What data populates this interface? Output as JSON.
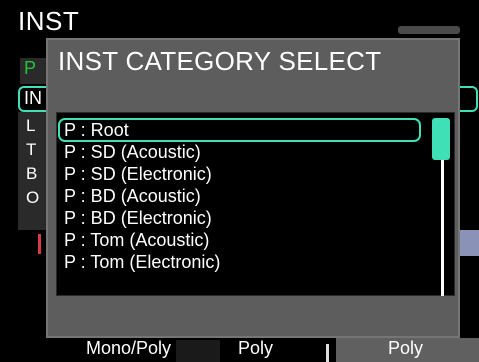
{
  "background": {
    "title": "INST",
    "highlight_letter": "P",
    "row_prefix": "IN",
    "letters": [
      "L",
      "T",
      "B",
      "O"
    ]
  },
  "dialog": {
    "title": "INST CATEGORY SELECT",
    "items": [
      "P : Root",
      "P : SD (Acoustic)",
      "P : SD (Electronic)",
      "P : BD (Acoustic)",
      "P : BD (Electronic)",
      "P : Tom (Acoustic)",
      "P : Tom (Electronic)"
    ],
    "selected_index": 0
  },
  "bottom_bar": {
    "left_label": "Mono/Poly",
    "mid_label": "Poly",
    "right_label": "Poly"
  },
  "colors": {
    "accent": "#3fe0b6",
    "dialog_bg": "#5d5d5d",
    "highlight_green": "#23c43c"
  }
}
